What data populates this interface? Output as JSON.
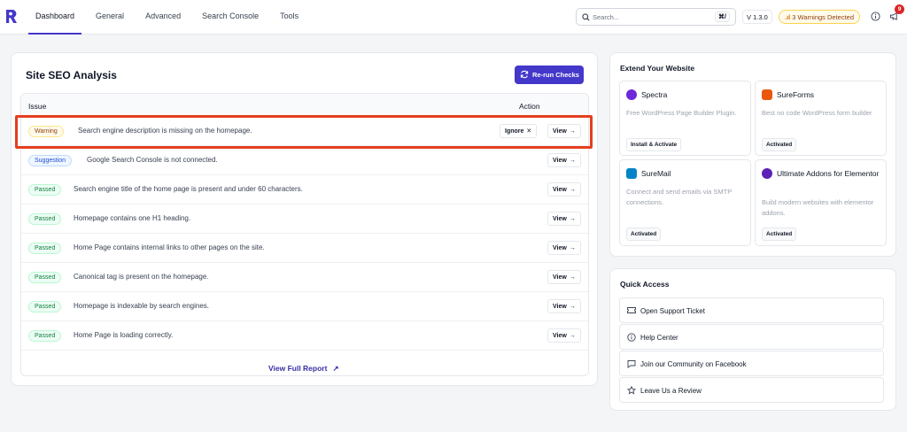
{
  "nav": {
    "tabs": [
      {
        "label": "Dashboard"
      },
      {
        "label": "General"
      },
      {
        "label": "Advanced"
      },
      {
        "label": "Search Console"
      },
      {
        "label": "Tools"
      }
    ],
    "search_placeholder": "Search...",
    "search_shortcut": "⌘/",
    "version": "V 1.3.0",
    "warnings": "3 Warnings Detected",
    "notification_count": "9",
    "accent_color": "#4338ca"
  },
  "analysis": {
    "title": "Site SEO Analysis",
    "rerun_label": "Re-run Checks",
    "col_issue": "Issue",
    "col_action": "Action",
    "rows": [
      {
        "status": "Warning",
        "text": "Search engine description is missing on the homepage.",
        "ignore": "Ignore",
        "view": "View"
      },
      {
        "status": "Suggestion",
        "text": "Google Search Console is not connected.",
        "view": "View"
      },
      {
        "status": "Passed",
        "text": "Search engine title of the home page is present and under 60 characters.",
        "view": "View"
      },
      {
        "status": "Passed",
        "text": "Homepage contains one H1 heading.",
        "view": "View"
      },
      {
        "status": "Passed",
        "text": "Home Page contains internal links to other pages on the site.",
        "view": "View"
      },
      {
        "status": "Passed",
        "text": "Canonical tag is present on the homepage.",
        "view": "View"
      },
      {
        "status": "Passed",
        "text": "Homepage is indexable by search engines.",
        "view": "View"
      },
      {
        "status": "Passed",
        "text": "Home Page is loading correctly.",
        "view": "View"
      }
    ],
    "view_full_report": "View Full Report"
  },
  "extend": {
    "title": "Extend Your Website",
    "plugins": [
      {
        "name": "Spectra",
        "desc": "Free WordPress Page Builder Plugin.",
        "button": "Install & Activate",
        "icon": "spectra-icon",
        "color": "#6d28d9"
      },
      {
        "name": "SureForms",
        "desc": "Best no code WordPress form builder",
        "button": "Activated",
        "icon": "sureforms-icon",
        "color": "#ea580c"
      },
      {
        "name": "SureMail",
        "desc": "Connect and send emails via SMTP connections.",
        "button": "Activated",
        "icon": "suremail-icon",
        "color": "#0284c7"
      },
      {
        "name": "Ultimate Addons for Elementor",
        "desc": "Build modern websites with elementor addons.",
        "button": "Activated",
        "icon": "uae-icon",
        "color": "#5b21b6"
      }
    ]
  },
  "quick_access": {
    "title": "Quick Access",
    "items": [
      {
        "label": "Open Support Ticket",
        "icon": "ticket-icon"
      },
      {
        "label": "Help Center",
        "icon": "help-circle-icon"
      },
      {
        "label": "Join our Community on Facebook",
        "icon": "chat-bubble-icon"
      },
      {
        "label": "Leave Us a Review",
        "icon": "star-icon"
      }
    ]
  }
}
